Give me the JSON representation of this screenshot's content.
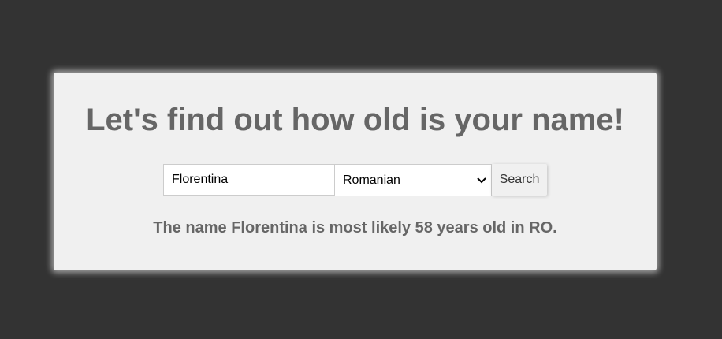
{
  "page": {
    "background_color": "#333333",
    "card_color": "#f0f0f0",
    "text_color": "#666666"
  },
  "main": {
    "title": "Let's find out how old is your name!",
    "name_input": {
      "value": "Florentina",
      "placeholder": ""
    },
    "language_select": {
      "selected": "Romanian",
      "icon": "chevron-down-icon"
    },
    "search_button_label": "Search",
    "result_text": "The name Florentina is most likely 58 years old in RO."
  }
}
